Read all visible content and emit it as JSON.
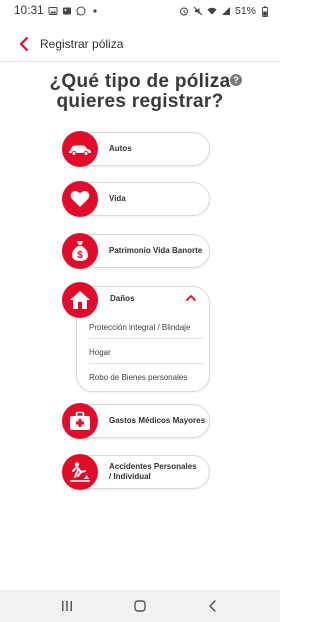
{
  "status_bar": {
    "time": "10:31",
    "battery": "51%"
  },
  "header": {
    "title": "Registrar póliza"
  },
  "page": {
    "title_line1": "¿Qué tipo de póliza",
    "title_line2": "quieres registrar?",
    "help": "?"
  },
  "options": [
    {
      "label": "Autos",
      "icon": "car-icon"
    },
    {
      "label": "Vida",
      "icon": "heart-icon"
    },
    {
      "label": "Patrimonio Vida Banorte",
      "icon": "money-bag-icon"
    },
    {
      "label": "Daños",
      "icon": "house-icon",
      "expanded": true,
      "sub_items": [
        "Protección integral / Blindaje",
        "Hogar",
        "Robo de Bienes personales"
      ]
    },
    {
      "label": "Gastos Médicos Mayores",
      "icon": "medical-kit-icon"
    },
    {
      "label_line1": "Accidentes Personales",
      "label_line2": "/ Individual",
      "icon": "slip-accident-icon"
    }
  ],
  "colors": {
    "brand_red": "#e30b2a",
    "text": "#333333"
  }
}
